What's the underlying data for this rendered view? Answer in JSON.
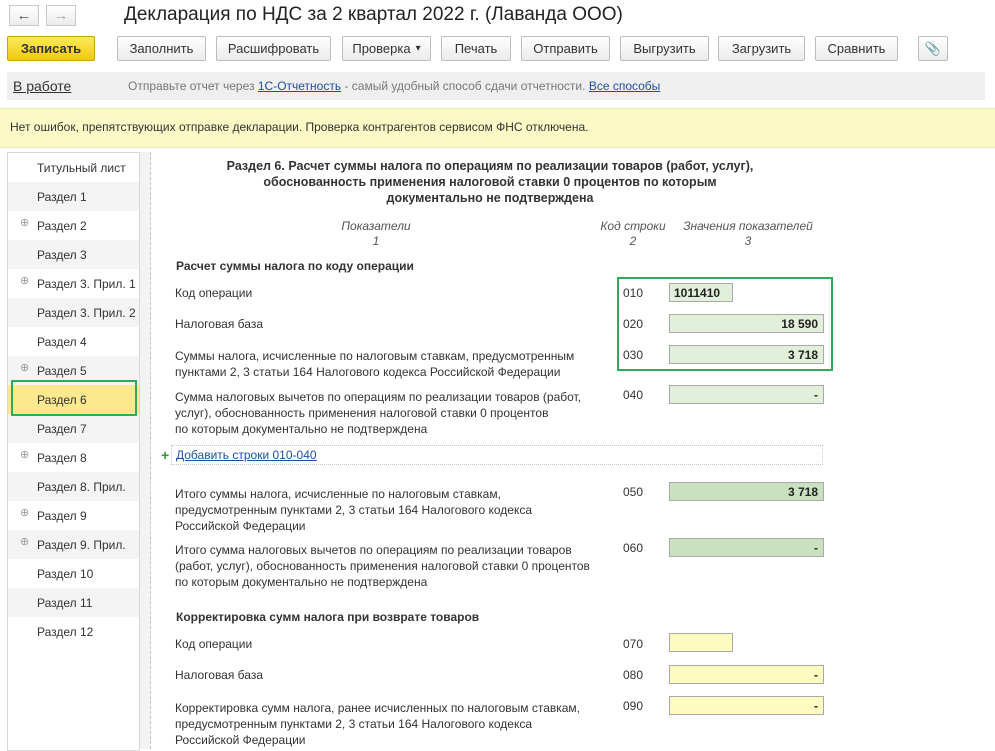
{
  "window": {
    "title": "Декларация по НДС за 2 квартал 2022 г. (Лаванда ООО)"
  },
  "nav": {
    "back_icon": "←",
    "forward_icon": "→"
  },
  "toolbar": {
    "save": "Записать",
    "fill": "Заполнить",
    "decode": "Расшифровать",
    "check": "Проверка",
    "check_arrow": "▾",
    "print": "Печать",
    "send": "Отправить",
    "export": "Выгрузить",
    "import": "Загрузить",
    "compare": "Сравнить",
    "attach_icon": "📎"
  },
  "status": {
    "state": "В работе",
    "message_prefix": "Отправьте отчет через",
    "service_link": "1С-Отчетность",
    "message_suffix": "- самый удобный способ сдачи отчетности.",
    "all_ways_link": "Все способы"
  },
  "info": {
    "message": "Нет ошибок, препятствующих отправке декларации. Проверка контрагентов сервисом ФНС отключена."
  },
  "sidebar": {
    "items": [
      {
        "label": "Титульный лист",
        "expandable": false
      },
      {
        "label": "Раздел 1",
        "expandable": false
      },
      {
        "label": "Раздел 2",
        "expandable": true
      },
      {
        "label": "Раздел 3",
        "expandable": false
      },
      {
        "label": "Раздел 3. Прил. 1",
        "expandable": true
      },
      {
        "label": "Раздел 3. Прил. 2",
        "expandable": false
      },
      {
        "label": "Раздел 4",
        "expandable": false
      },
      {
        "label": "Раздел 5",
        "expandable": true
      },
      {
        "label": "Раздел 6",
        "expandable": false
      },
      {
        "label": "Раздел 7",
        "expandable": false
      },
      {
        "label": "Раздел 8",
        "expandable": true
      },
      {
        "label": "Раздел 8. Прил.",
        "expandable": false
      },
      {
        "label": "Раздел 9",
        "expandable": true
      },
      {
        "label": "Раздел 9. Прил.",
        "expandable": true
      },
      {
        "label": "Раздел 10",
        "expandable": false
      },
      {
        "label": "Раздел 11",
        "expandable": false
      },
      {
        "label": "Раздел 12",
        "expandable": false
      }
    ],
    "expand_icon": "⊕",
    "selected": "Раздел 6"
  },
  "section": {
    "title_line1": "Раздел 6. Расчет суммы налога по операциям по реализации товаров (работ, услуг),",
    "title_line2": "обоснованность применения налоговой ставки 0 процентов по которым",
    "title_line3": "документально не подтверждена",
    "col1_header": "Показатели",
    "col1_num": "1",
    "col2_header": "Код строки",
    "col2_num": "2",
    "col3_header": "Значения показателей",
    "col3_num": "3",
    "group1_title": "Расчет суммы налога по коду операции",
    "group2_title": "Корректировка сумм налога при возврате товаров",
    "add_rows_icon": "+",
    "add_rows_link": "Добавить строки 010-040"
  },
  "rows": {
    "r010": {
      "label": "Код операции",
      "code": "010",
      "value": "1011410"
    },
    "r020": {
      "label": "Налоговая база",
      "code": "020",
      "value": "18 590"
    },
    "r030": {
      "label_l1": "Суммы налога, исчисленные по налоговым ставкам, предусмотренным",
      "label_l2": "пунктами 2, 3 статьи 164 Налогового кодекса Российской Федерации",
      "code": "030",
      "value": "3 718"
    },
    "r040": {
      "label_l1": "Сумма налоговых вычетов по операциям по реализации товаров (работ,",
      "label_l2": "услуг), обоснованность применения налоговой ставки 0 процентов",
      "label_l3": "по которым документально не подтверждена",
      "code": "040",
      "value": "-"
    },
    "r050": {
      "label_l1": "Итого суммы налога, исчисленные по налоговым ставкам,",
      "label_l2": "предусмотренным пунктами 2, 3 статьи 164 Налогового кодекса",
      "label_l3": "Российской Федерации",
      "code": "050",
      "value": "3 718"
    },
    "r060": {
      "label_l1": "Итого сумма налоговых вычетов по операциям по реализации товаров",
      "label_l2": "(работ, услуг), обоснованность применения налоговой ставки 0 процентов",
      "label_l3": "по которым документально не подтверждена",
      "code": "060",
      "value": "-"
    },
    "r070": {
      "label": "Код операции",
      "code": "070",
      "value": ""
    },
    "r080": {
      "label": "Налоговая база",
      "code": "080",
      "value": "-"
    },
    "r090": {
      "label_l1": "Корректировка сумм налога, ранее исчисленных по налоговым ставкам,",
      "label_l2": "предусмотренным пунктами 2, 3 статьи 164 Налогового кодекса",
      "label_l3": "Российской Федерации",
      "code": "090",
      "value": "-"
    }
  },
  "colors": {
    "highlight": "#2daa5a",
    "primary_button": "#f5d42a",
    "info_bar": "#fbf9c6",
    "selected_item": "#fbe88f"
  }
}
